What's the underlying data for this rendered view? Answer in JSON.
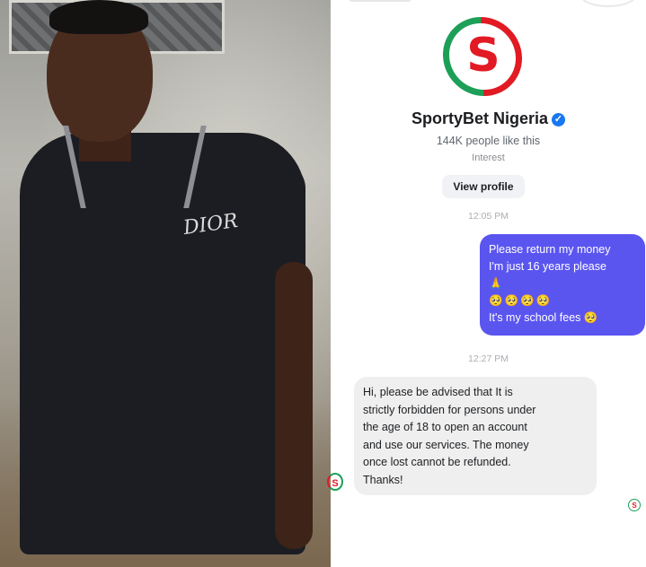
{
  "photo": {
    "shirt_logo": "DIOR"
  },
  "page": {
    "name": "SportyBet Nigeria",
    "likes": "144K people like this",
    "category": "Interest",
    "view_profile_label": "View profile",
    "logo_letter": "S",
    "verified_glyph": "✓",
    "verified_icon": "check-badge-icon"
  },
  "messages": {
    "timestamp_1": "12:05 PM",
    "outgoing": {
      "line1": "Please return my money",
      "line2": "I'm just 16 years please",
      "line3": "🙏",
      "line4": "🥺🥺🥺🥺",
      "line5": "It's my school fees 🥺"
    },
    "timestamp_2": "12:27 PM",
    "incoming": {
      "line1": "Hi, please be advised that It is",
      "line2": "strictly forbidden for persons under",
      "line3": "the age of 18 to open an account",
      "line4": "and use our services. The money",
      "line5": "once lost cannot be refunded.",
      "line6": "Thanks!"
    },
    "sender_avatar_letter": "S",
    "seen_avatar_letter": "S"
  },
  "colors": {
    "brand_red": "#e21a23",
    "brand_green": "#1d9f58",
    "outgoing_bubble": "#5b55f0",
    "incoming_bubble": "#efefef",
    "verified_blue": "#1877f2"
  }
}
